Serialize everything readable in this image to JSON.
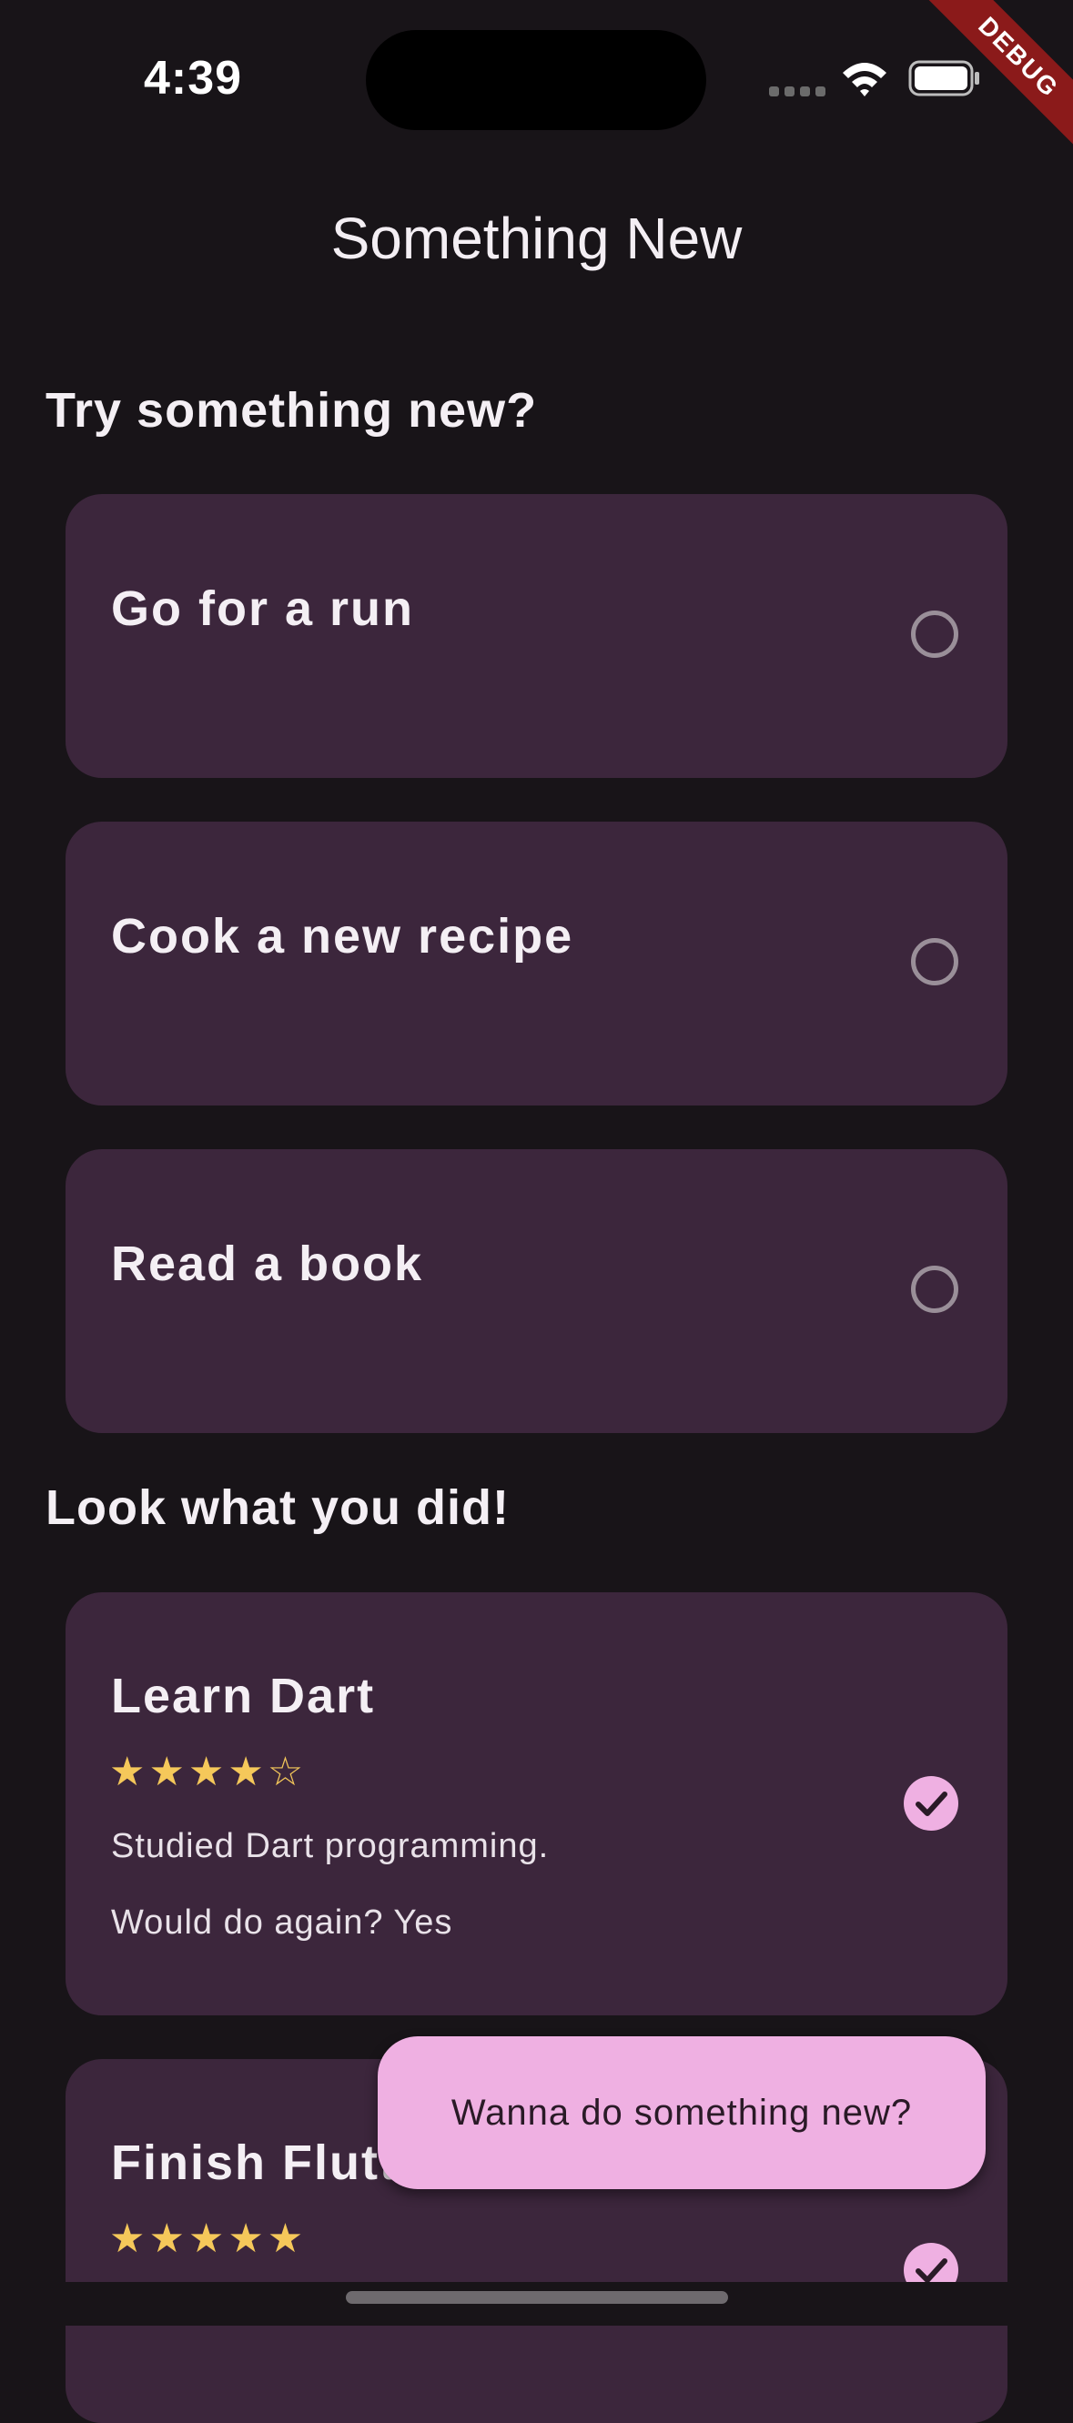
{
  "status_bar": {
    "time": "4:39",
    "debug_label": "DEBUG"
  },
  "app_bar": {
    "title": "Something New"
  },
  "sections": {
    "todo_title": "Try something new?",
    "done_title": "Look what you did!"
  },
  "todo_items": [
    {
      "title": "Go for a run",
      "checked": false
    },
    {
      "title": "Cook a new recipe",
      "checked": false
    },
    {
      "title": "Read a book",
      "checked": false
    }
  ],
  "done_items": [
    {
      "title": "Learn Dart",
      "rating": 4,
      "rating_max": 5,
      "stars": "★★★★☆",
      "note": "Studied Dart programming.",
      "again": "Would do again? Yes",
      "checked": true
    },
    {
      "title": "Finish Flutter",
      "rating": 5,
      "rating_max": 5,
      "stars": "★★★★★",
      "checked": true
    }
  ],
  "fab": {
    "label": "Wanna do something new?"
  },
  "colors": {
    "background": "#181418",
    "card": "#3c263c",
    "accent": "#efb0e2",
    "star": "#f5c85a",
    "debug_ribbon": "#8b1a1a"
  },
  "icons": {
    "radio": "radio-unchecked-icon",
    "check": "check-circle-icon",
    "wifi": "wifi-icon",
    "battery": "battery-icon",
    "signal": "signal-dots-icon"
  }
}
